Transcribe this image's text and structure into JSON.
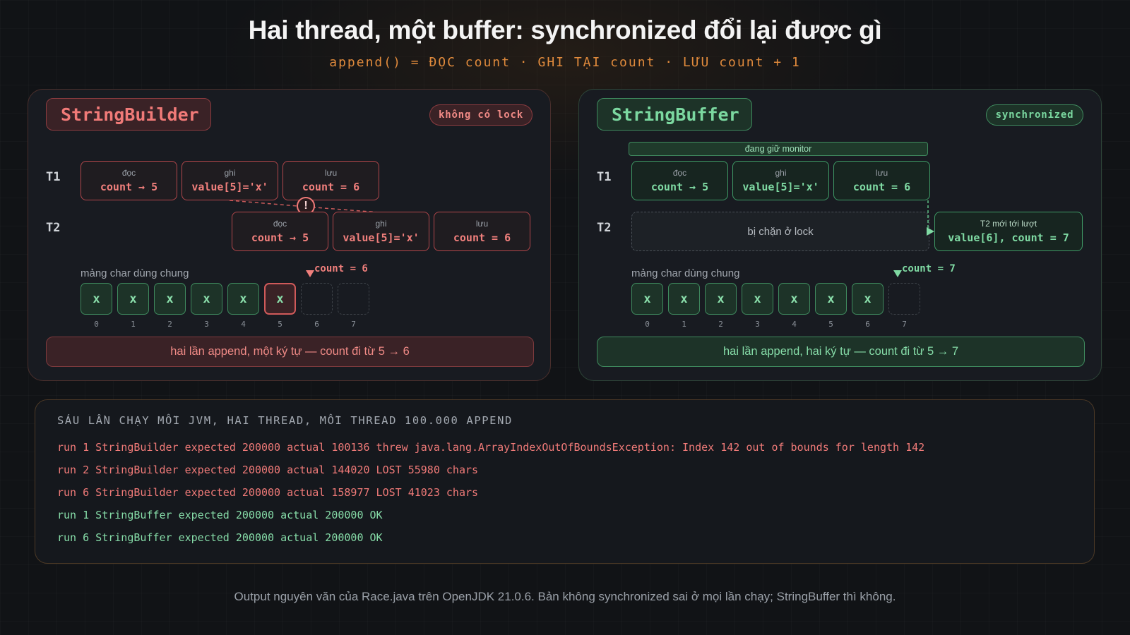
{
  "title": "Hai thread, một buffer: synchronized đổi lại được gì",
  "subtitle": "append() = ĐỌC count · GHI TẠI count · LƯU count + 1",
  "colors": {
    "bad": "#f07a78",
    "good": "#7fdaa3",
    "accent": "#e08a3c",
    "background": "#111316"
  },
  "left_panel": {
    "title": "StringBuilder",
    "badge": "không có lock",
    "t1_label": "T1",
    "t2_label": "T2",
    "t1_steps": [
      {
        "label": "đọc",
        "value": "count → 5"
      },
      {
        "label": "ghi",
        "value": "value[5]='x'"
      },
      {
        "label": "lưu",
        "value": "count = 6"
      }
    ],
    "t2_steps": [
      {
        "label": "đọc",
        "value": "count → 5"
      },
      {
        "label": "ghi",
        "value": "value[5]='x'"
      },
      {
        "label": "lưu",
        "value": "count = 6"
      }
    ],
    "conflict_icon": "exclamation-icon",
    "conflict_symbol": "!",
    "array_label": "mảng char dùng chung",
    "cells": [
      "x",
      "x",
      "x",
      "x",
      "x",
      "x",
      "",
      ""
    ],
    "indices": [
      "0",
      "1",
      "2",
      "3",
      "4",
      "5",
      "6",
      "7"
    ],
    "count_marker": "count = 6",
    "summary": "hai lần append, một ký tự — count đi từ 5 → 6"
  },
  "right_panel": {
    "title": "StringBuffer",
    "badge": "synchronized",
    "monitor_label": "đang giữ monitor",
    "t1_label": "T1",
    "t2_label": "T2",
    "t1_steps": [
      {
        "label": "đọc",
        "value": "count → 5"
      },
      {
        "label": "ghi",
        "value": "value[5]='x'"
      },
      {
        "label": "lưu",
        "value": "count = 6"
      }
    ],
    "blocked_label": "bị chặn ở lock",
    "t2_turn": {
      "label": "T2 mới tới lượt",
      "value": "value[6], count = 7"
    },
    "array_label": "mảng char dùng chung",
    "cells": [
      "x",
      "x",
      "x",
      "x",
      "x",
      "x",
      "x",
      ""
    ],
    "indices": [
      "0",
      "1",
      "2",
      "3",
      "4",
      "5",
      "6",
      "7"
    ],
    "count_marker": "count = 7",
    "summary": "hai lần append, hai ký tự — count đi từ 5 → 7"
  },
  "log": {
    "title": "SÁU LẦN CHẠY MỖI JVM, HAI THREAD, MỖI THREAD 100.000 APPEND",
    "lines": [
      {
        "text": "run 1 StringBuilder expected 200000 actual 100136 threw java.lang.ArrayIndexOutOfBoundsException: Index 142 out of bounds for length 142",
        "status": "bad"
      },
      {
        "text": "run 2 StringBuilder expected 200000 actual 144020 LOST 55980 chars",
        "status": "bad"
      },
      {
        "text": "run 6 StringBuilder expected 200000 actual 158977 LOST 41023 chars",
        "status": "bad"
      },
      {
        "text": "run 1 StringBuffer expected 200000 actual 200000 OK",
        "status": "ok"
      },
      {
        "text": "run 6 StringBuffer expected 200000 actual 200000 OK",
        "status": "ok"
      }
    ]
  },
  "footer": "Output nguyên văn của Race.java trên OpenJDK 21.0.6. Bản không synchronized sai ở mọi lần chạy; StringBuffer thì không."
}
